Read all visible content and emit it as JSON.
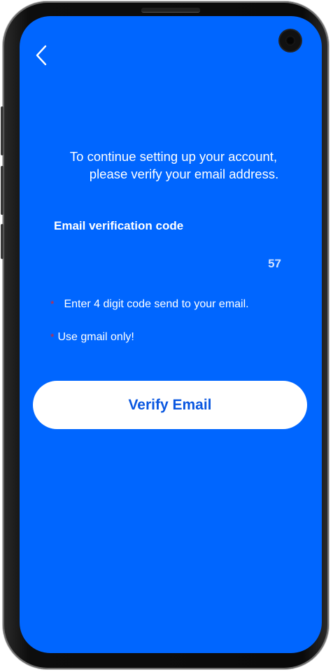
{
  "header": {
    "back_icon": "chevron-left-icon"
  },
  "intro": {
    "line1": "To continue setting up your account,",
    "line2": "please verify your email address."
  },
  "form": {
    "code_label": "Email verification code",
    "code_value": "",
    "code_counter": "57",
    "hint_required_symbol": "*",
    "hint_enter_code": "Enter 4 digit code send to your email.",
    "hint_gmail": "Use gmail only!"
  },
  "actions": {
    "verify_label": "Verify Email"
  },
  "colors": {
    "background": "#0066ff",
    "button_bg": "#ffffff",
    "button_text": "#0a57e0",
    "required_star": "#e0242a"
  }
}
